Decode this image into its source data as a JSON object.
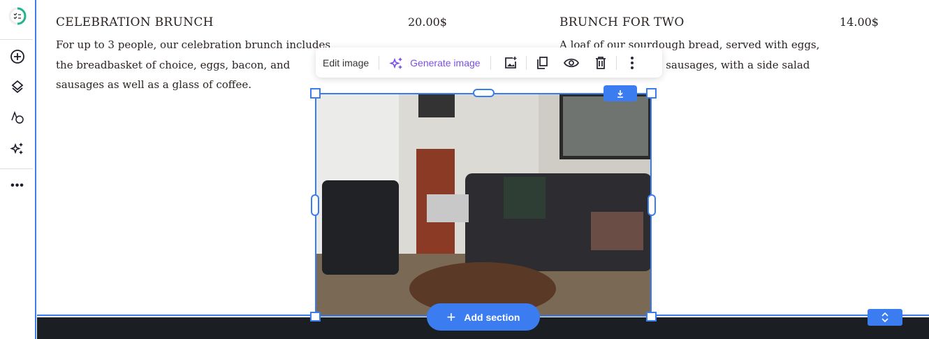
{
  "sidebar": {
    "items": [
      "progress-checklist",
      "add",
      "layers",
      "theme",
      "ai-assistant",
      "more"
    ]
  },
  "menu": [
    {
      "title": "CELEBRATION BRUNCH",
      "price": "20.00$",
      "description": "For up to 3 people, our celebration brunch includes the breadbasket of choice, eggs, bacon, and sausages as well as a glass of coffee."
    },
    {
      "title": "BRUNCH FOR TWO",
      "price": "14.00$",
      "description": "A loaf of our sourdough bread, served with eggs, and locally sourced sausages, with a side salad"
    }
  ],
  "toolbar": {
    "edit_image": "Edit image",
    "generate_image": "Generate image",
    "accent": "#7b4fe6"
  },
  "add_section": "Add section",
  "colors": {
    "selection": "#3b7df0",
    "footer": "#1b1f24"
  }
}
